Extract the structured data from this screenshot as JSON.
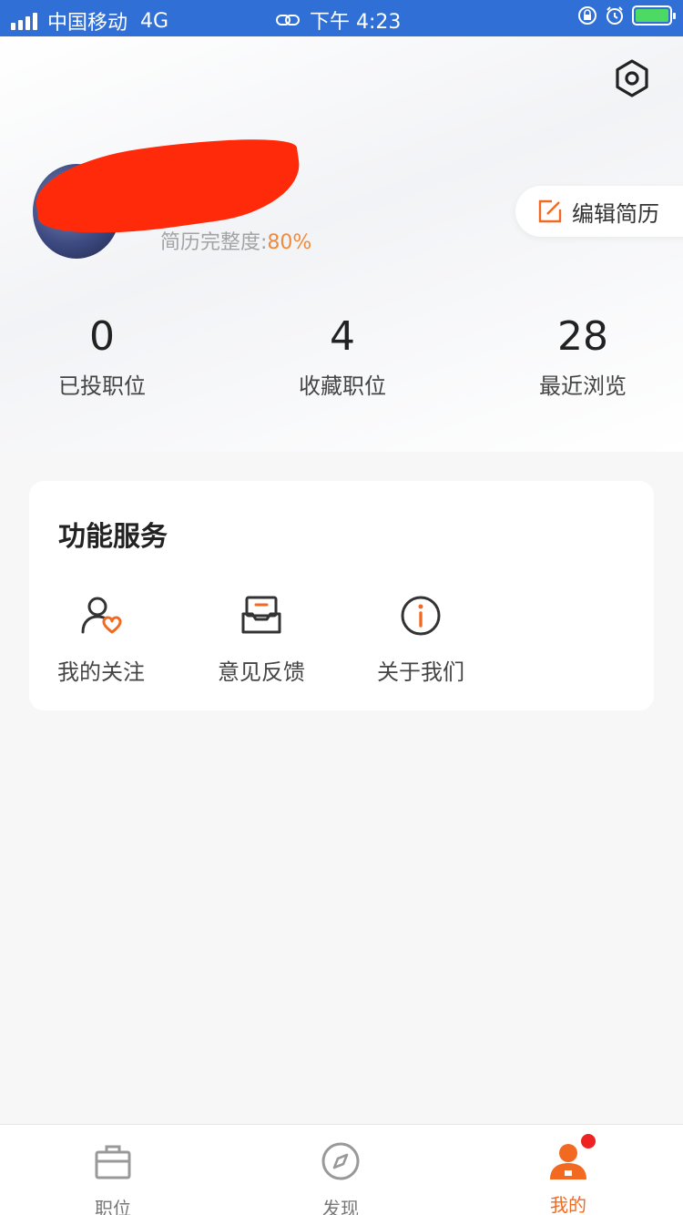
{
  "status_bar": {
    "carrier": "中国移动",
    "network": "4G",
    "time": "下午 4:23"
  },
  "profile": {
    "completeness_label": "简历完整度:",
    "completeness_value": "80%",
    "edit_resume_label": "编辑简历"
  },
  "stats": [
    {
      "value": "0",
      "label": "已投职位"
    },
    {
      "value": "4",
      "label": "收藏职位"
    },
    {
      "value": "28",
      "label": "最近浏览"
    }
  ],
  "services": {
    "title": "功能服务",
    "items": [
      {
        "label": "我的关注",
        "icon": "user-heart-icon"
      },
      {
        "label": "意见反馈",
        "icon": "feedback-box-icon"
      },
      {
        "label": "关于我们",
        "icon": "info-icon"
      }
    ]
  },
  "tabbar": {
    "tabs": [
      {
        "label": "职位",
        "icon": "briefcase-icon"
      },
      {
        "label": "发现",
        "icon": "compass-icon"
      },
      {
        "label": "我的",
        "icon": "person-icon"
      }
    ]
  },
  "colors": {
    "accent": "#f26a21",
    "status_bar": "#2f6fd6",
    "badge": "#ee2222"
  }
}
